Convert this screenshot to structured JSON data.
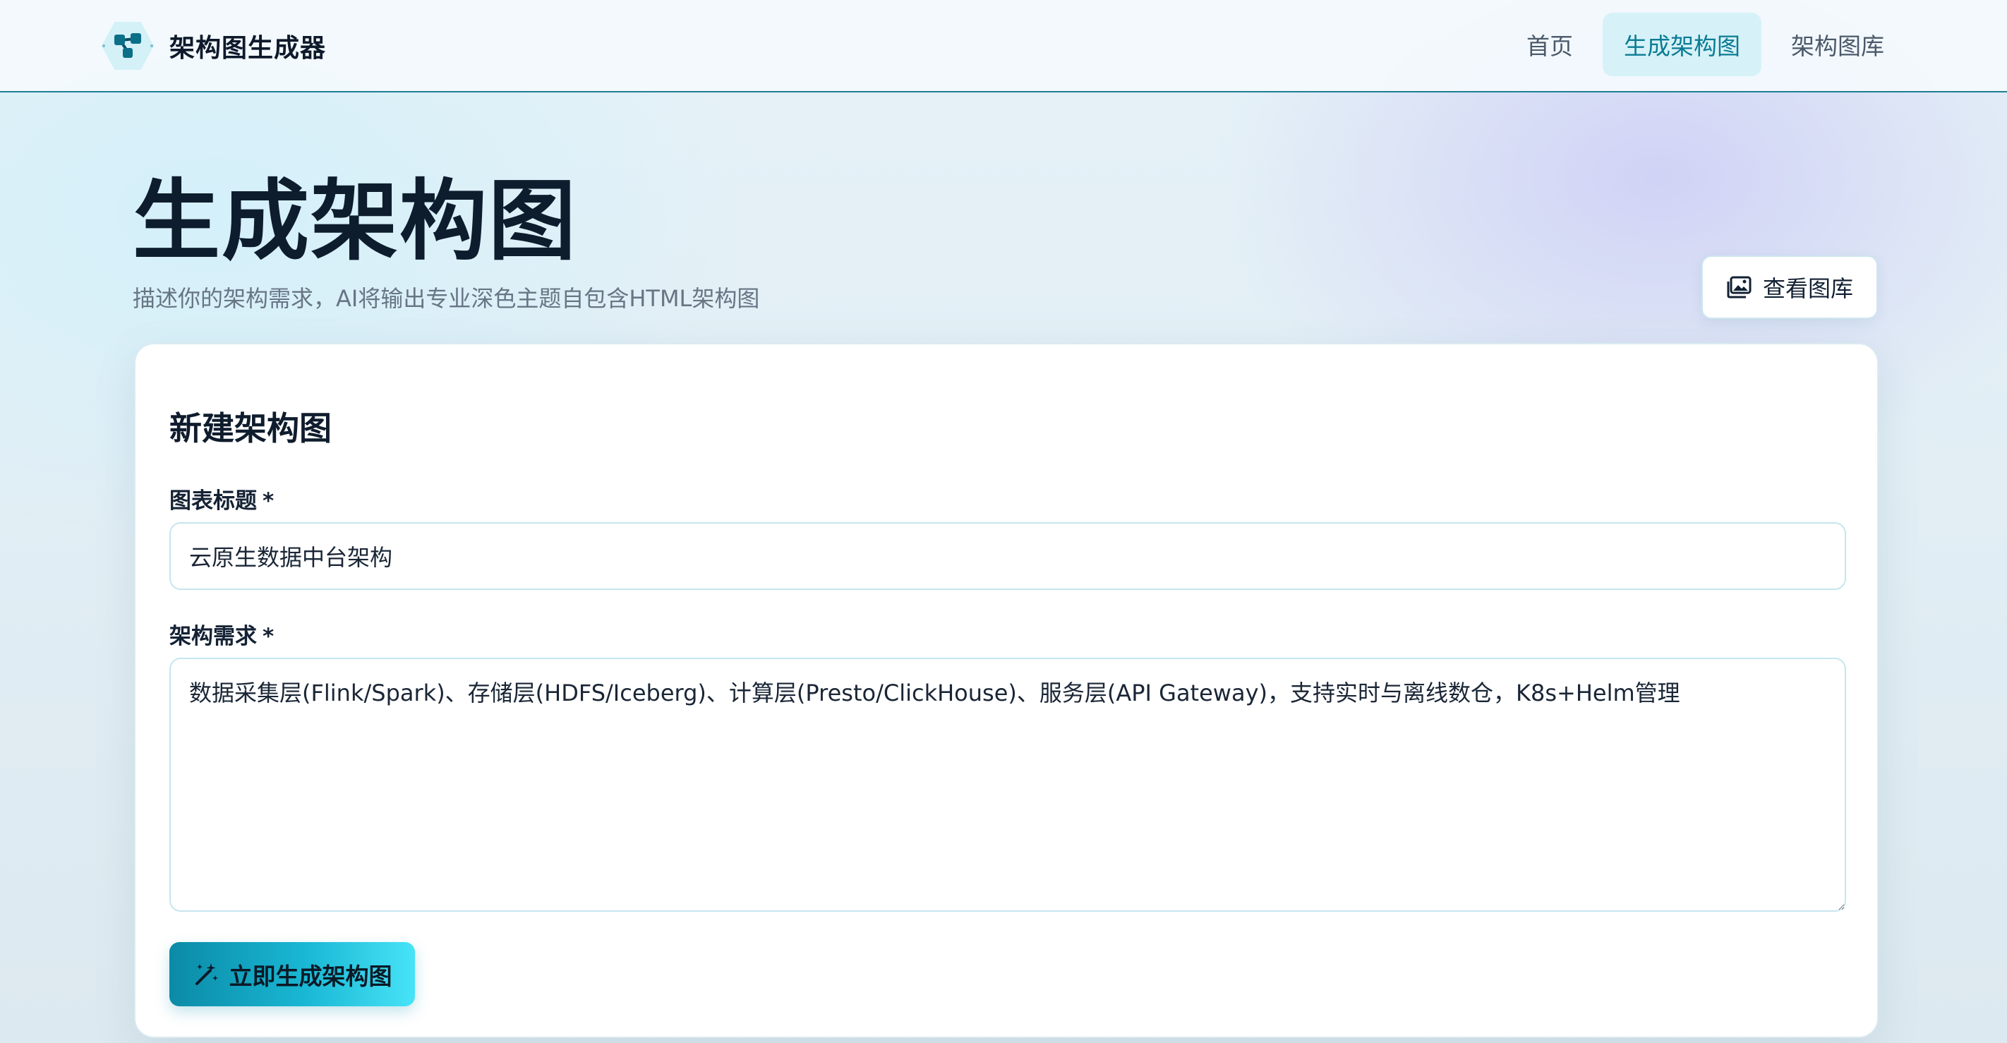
{
  "app": {
    "name": "架构图生成器"
  },
  "nav": {
    "items": [
      {
        "label": "首页",
        "active": false
      },
      {
        "label": "生成架构图",
        "active": true
      },
      {
        "label": "架构图库",
        "active": false
      }
    ]
  },
  "page": {
    "title": "生成架构图",
    "subtitle": "描述你的架构需求，AI将输出专业深色主题自包含HTML架构图",
    "gallery_button": "查看图库"
  },
  "form": {
    "heading": "新建架构图",
    "title_label": "图表标题",
    "title_required": "*",
    "title_value": "云原生数据中台架构",
    "req_label": "架构需求",
    "req_required": "*",
    "req_value": "数据采集层(Flink/Spark)、存储层(HDFS/Iceberg)、计算层(Presto/ClickHouse)、服务层(API Gateway)，支持实时与离线数仓，K8s+Helm管理",
    "submit_label": "立即生成架构图"
  },
  "colors": {
    "accent": "#0b7c94",
    "nav_active_bg": "#d6f2f8",
    "button_gradient_start": "#0b8aa6",
    "button_gradient_end": "#47e3f7",
    "header_border": "#1f7e93"
  },
  "icons": {
    "logo": "network-nodes-icon",
    "gallery": "images-icon",
    "generate": "magic-wand-icon"
  }
}
